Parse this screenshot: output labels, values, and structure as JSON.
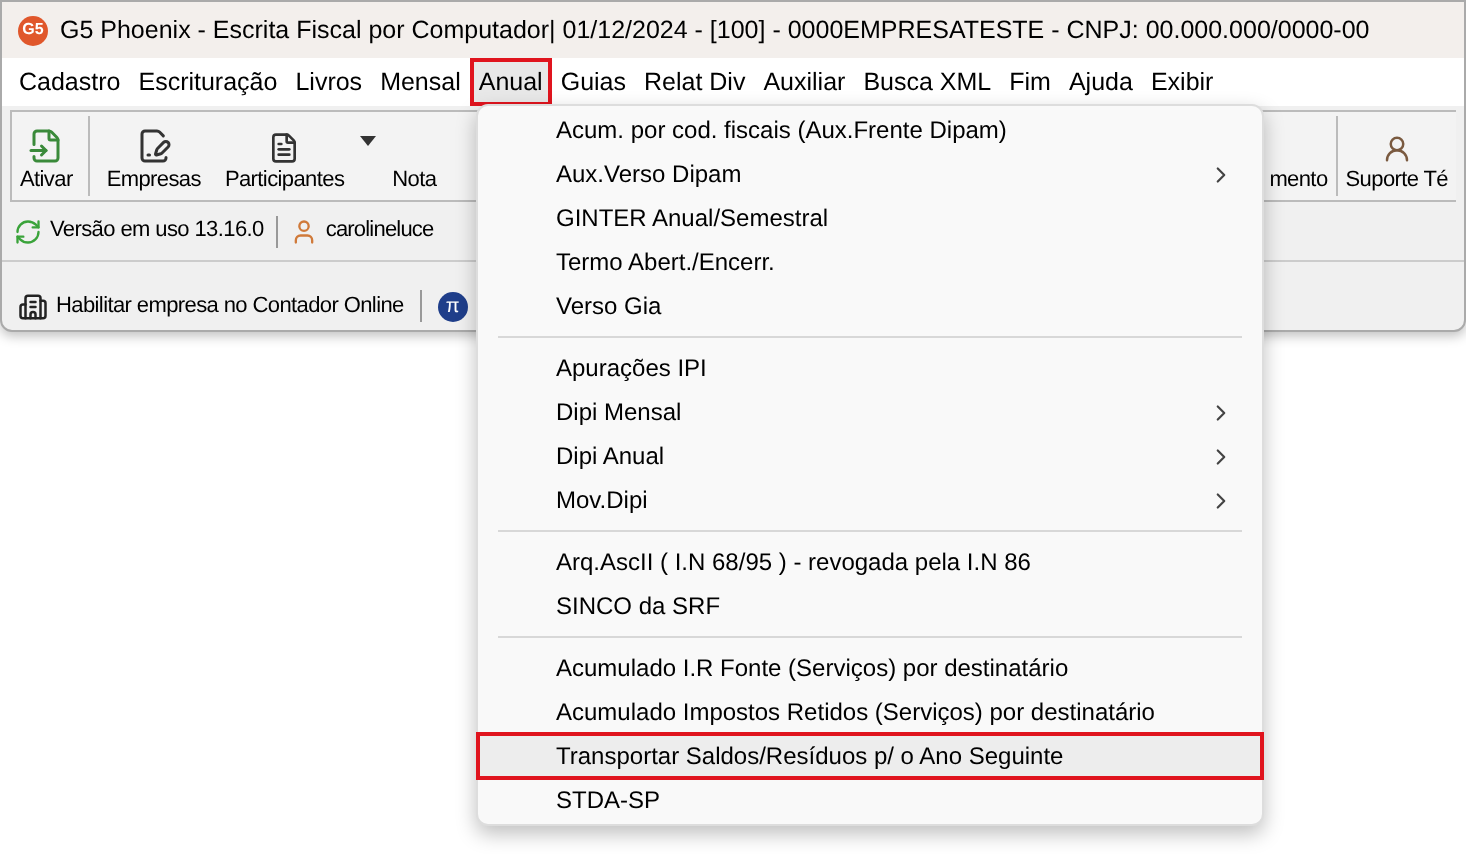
{
  "window": {
    "title": "G5 Phoenix - Escrita Fiscal por Computador|  01/12/2024 - [100] - 0000EMPRESATESTE - CNPJ: 00.000.000/0000-00",
    "logo": "G5"
  },
  "menubar": [
    {
      "label": "Cadastro",
      "selected": false,
      "annotated": false
    },
    {
      "label": "Escrituração",
      "selected": false,
      "annotated": false
    },
    {
      "label": "Livros",
      "selected": false,
      "annotated": false
    },
    {
      "label": "Mensal",
      "selected": false,
      "annotated": false
    },
    {
      "label": "Anual",
      "selected": true,
      "annotated": true
    },
    {
      "label": "Guias",
      "selected": false,
      "annotated": false
    },
    {
      "label": "Relat Div",
      "selected": false,
      "annotated": false
    },
    {
      "label": "Auxiliar",
      "selected": false,
      "annotated": false
    },
    {
      "label": "Busca XML",
      "selected": false,
      "annotated": false
    },
    {
      "label": "Fim",
      "selected": false,
      "annotated": false
    },
    {
      "label": "Ajuda",
      "selected": false,
      "annotated": false
    },
    {
      "label": "Exibir",
      "selected": false,
      "annotated": false
    }
  ],
  "toolbar": {
    "left": [
      {
        "label": "Ativar",
        "kind": "ativar"
      },
      {
        "label": "Empresas",
        "kind": "empresas"
      },
      {
        "label": "Participantes",
        "kind": "participantes",
        "dropdown": true
      },
      {
        "label": "Nota",
        "kind": "plain"
      }
    ],
    "right": [
      {
        "label": "mento",
        "kind": "plain"
      },
      {
        "label": "Suporte Té",
        "kind": "suporte"
      }
    ]
  },
  "info_bar": {
    "version": "Versão em uso 13.16.0",
    "user": "carolineluce"
  },
  "bottom_bar": {
    "link": "Habilitar empresa no Contador Online",
    "pi_icon": "π"
  },
  "dropdown": [
    [
      {
        "label": "Acum. por cod. fiscais (Aux.Frente Dipam)",
        "submenu": false,
        "selected": false,
        "annotated": false
      },
      {
        "label": "Aux.Verso Dipam",
        "submenu": true,
        "selected": false,
        "annotated": false
      },
      {
        "label": "GINTER Anual/Semestral",
        "submenu": false,
        "selected": false,
        "annotated": false
      },
      {
        "label": "Termo Abert./Encerr.",
        "submenu": false,
        "selected": false,
        "annotated": false
      },
      {
        "label": "Verso Gia",
        "submenu": false,
        "selected": false,
        "annotated": false
      }
    ],
    [
      {
        "label": "Apurações IPI",
        "submenu": false,
        "selected": false,
        "annotated": false
      },
      {
        "label": "Dipi Mensal",
        "submenu": true,
        "selected": false,
        "annotated": false
      },
      {
        "label": "Dipi Anual",
        "submenu": true,
        "selected": false,
        "annotated": false
      },
      {
        "label": "Mov.Dipi",
        "submenu": true,
        "selected": false,
        "annotated": false
      }
    ],
    [
      {
        "label": "Arq.AscII ( I.N 68/95 ) - revogada pela I.N 86",
        "submenu": false,
        "selected": false,
        "annotated": false
      },
      {
        "label": "SINCO da SRF",
        "submenu": false,
        "selected": false,
        "annotated": false
      }
    ],
    [
      {
        "label": "Acumulado I.R Fonte (Serviços) por destinatário",
        "submenu": false,
        "selected": false,
        "annotated": false
      },
      {
        "label": "Acumulado Impostos Retidos (Serviços) por destinatário",
        "submenu": false,
        "selected": false,
        "annotated": false
      },
      {
        "label": "Transportar Saldos/Resíduos p/ o Ano Seguinte",
        "submenu": false,
        "selected": true,
        "annotated": true
      },
      {
        "label": "STDA-SP",
        "submenu": false,
        "selected": false,
        "annotated": false
      }
    ]
  ]
}
